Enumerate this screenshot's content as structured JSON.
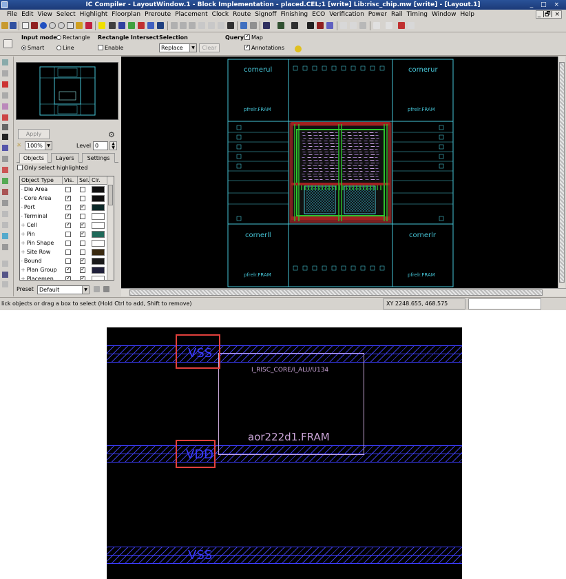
{
  "window": {
    "title": "IC Compiler - LayoutWindow.1 - Block Implementation - placed.CEL;1 [write]     Lib:risc_chip.mw [write] - [Layout.1]",
    "controls": "_ □ ×",
    "mdi_controls": "_ |🗗| ×"
  },
  "menu": [
    "File",
    "Edit",
    "View",
    "Select",
    "Highlight",
    "Floorplan",
    "Preroute",
    "Placement",
    "Clock",
    "Route",
    "Signoff",
    "Finishing",
    "ECO",
    "Verification",
    "Power",
    "Rail",
    "Timing",
    "Window",
    "Help"
  ],
  "options": {
    "input_mode_label": "Input mode",
    "rectangle_label": "Rectangle",
    "line_label": "Line",
    "smart_label": "Smart",
    "rect_intersect_label": "Rectangle Intersect",
    "enable_label": "Enable",
    "selection_label": "Selection",
    "selection_value": "Replace",
    "clear_label": "Clear",
    "query_label": "Query",
    "map_label": "Map",
    "annotations_label": "Annotations"
  },
  "side_panel": {
    "apply_label": "Apply",
    "zoom_value": "100%",
    "level_label": "Level",
    "level_value": "0",
    "tabs": [
      "Objects",
      "Layers",
      "Settings"
    ],
    "only_select_label": "Only select highlighted",
    "table_headers": [
      "Object Type",
      "Vis.",
      "Sel.",
      "Clr."
    ],
    "rows": [
      {
        "name": "Die Area",
        "prefix": "-",
        "vis": false,
        "sel": false,
        "color": "#101010"
      },
      {
        "name": "Core Area",
        "prefix": "-",
        "vis": true,
        "sel": false,
        "color": "#101010"
      },
      {
        "name": "Port",
        "prefix": "-",
        "vis": true,
        "sel": true,
        "color": "#0d2a2a"
      },
      {
        "name": "Terminal",
        "prefix": "-",
        "vis": true,
        "sel": false,
        "color": "#ffffff"
      },
      {
        "name": "Cell",
        "prefix": "+",
        "vis": true,
        "sel": true,
        "color": "#ffffff"
      },
      {
        "name": "Pin",
        "prefix": "+",
        "vis": false,
        "sel": true,
        "color": "#1f6a5a"
      },
      {
        "name": "Pin Shape",
        "prefix": "+",
        "vis": false,
        "sel": false,
        "color": "#ffffff"
      },
      {
        "name": "Site Row",
        "prefix": "+",
        "vis": false,
        "sel": false,
        "color": "#3a2a10"
      },
      {
        "name": "Bound",
        "prefix": "-",
        "vis": false,
        "sel": true,
        "color": "#1a1a1a"
      },
      {
        "name": "Plan Group",
        "prefix": "+",
        "vis": true,
        "sel": true,
        "color": "#20203a"
      },
      {
        "name": "Placemen",
        "prefix": "+",
        "vis": true,
        "sel": true,
        "color": "#ffffff"
      }
    ],
    "preset_label": "Preset",
    "preset_value": "Default"
  },
  "canvas": {
    "corners": {
      "ul": "cornerul",
      "ur": "cornerur",
      "ll": "cornerll",
      "lr": "cornerlr"
    },
    "pad_cell": "pfrelr.FRAM"
  },
  "status": {
    "message": "lick objects or drag a box to select (Hold Ctrl to add, Shift to remove)",
    "xy": "XY 2248.655, 468.575"
  },
  "zoom_view": {
    "vss_top": "VSS",
    "vdd": "VDD",
    "vss_bottom": "VSS",
    "cell_instance": "I_RISC_CORE/I_ALU/U134",
    "cell_ref": "aor222d1.FRAM"
  },
  "colors": {
    "title_bar": "#1b3a78",
    "layout_cyan": "#46c6d8",
    "rail_blue": "#3c3cff",
    "highlight_red": "#e2403c",
    "cell_outline": "#c8a8d8"
  }
}
